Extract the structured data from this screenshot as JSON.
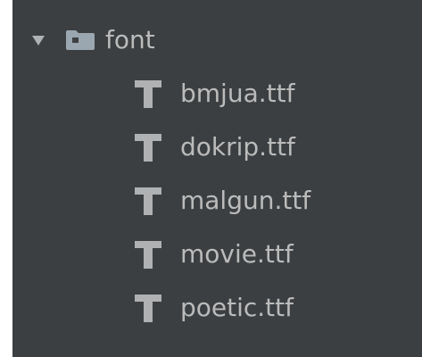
{
  "tree": {
    "folder": {
      "name": "font",
      "expanded": true,
      "icon": "folder-icon"
    },
    "files": [
      {
        "name": "bmjua.ttf",
        "icon": "font-file-icon"
      },
      {
        "name": "dokrip.ttf",
        "icon": "font-file-icon"
      },
      {
        "name": "malgun.ttf",
        "icon": "font-file-icon"
      },
      {
        "name": "movie.ttf",
        "icon": "font-file-icon"
      },
      {
        "name": "poetic.ttf",
        "icon": "font-file-icon"
      }
    ]
  },
  "colors": {
    "background": "#3c3f41",
    "text": "#bbbbbb",
    "icon": "#afb1b3",
    "folder_icon": "#9aa7b0"
  }
}
